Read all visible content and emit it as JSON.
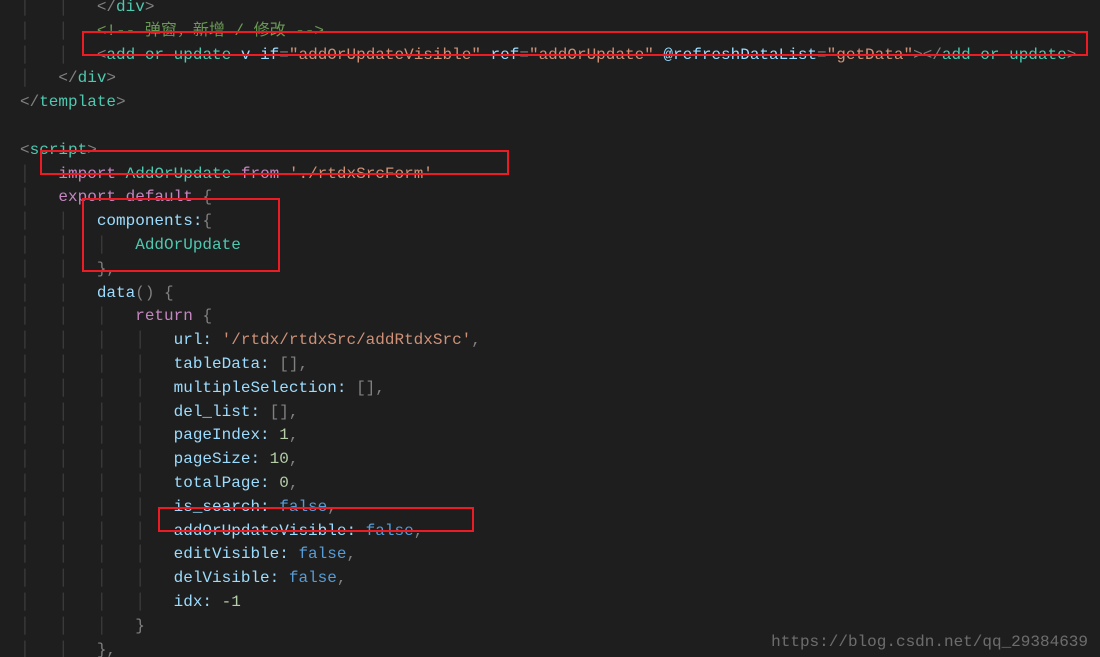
{
  "code": {
    "line01_close": "</div>",
    "line02_comment": "<!-- 弹窗，新增 / 修改 -->",
    "line03_tag": "add-or-update",
    "line03_attr1": "v-if",
    "line03_val1": "addOrUpdateVisible",
    "line03_attr2": "ref",
    "line03_val2": "addOrUpdate",
    "line03_attr3": "@refreshDataList",
    "line03_val3": "getData",
    "line04_close_div": "div",
    "line05_template": "template",
    "line07_script": "script",
    "line08_import": "import",
    "line08_name": "AddOrUpdate",
    "line08_from": "from",
    "line08_path": "'./rtdxSrcForm'",
    "line09_export": "export default",
    "line10_components": "components:",
    "line11_add": "AddOrUpdate",
    "line13_data": "data",
    "line14_return": "return",
    "line15_key": "url:",
    "line15_val": "'/rtdx/rtdxSrc/addRtdxSrc'",
    "line16_key": "tableData:",
    "line16_val": "[]",
    "line17_key": "multipleSelection:",
    "line17_val": "[]",
    "line18_key": "del_list:",
    "line18_val": "[]",
    "line19_key": "pageIndex:",
    "line19_val": "1",
    "line20_key": "pageSize:",
    "line20_val": "10",
    "line21_key": "totalPage:",
    "line21_val": "0",
    "line22_key": "is_search:",
    "line22_val": "false",
    "line23_key": "addOrUpdateVisible:",
    "line23_val": "false",
    "line24_key": "editVisible:",
    "line24_val": "false",
    "line25_key": "delVisible:",
    "line25_val": "false",
    "line26_key": "idx:",
    "line26_val": "-1"
  },
  "watermark": "https://blog.csdn.net/qq_29384639"
}
